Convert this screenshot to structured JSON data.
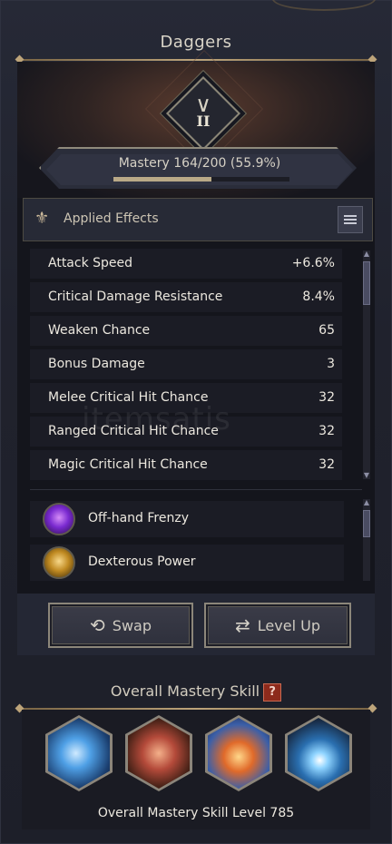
{
  "header": {
    "title": "Daggers"
  },
  "rank": {
    "numeral": "II"
  },
  "mastery": {
    "label": "Mastery 164/200 (55.9%)",
    "progress": 0.559
  },
  "effects": {
    "title": "Applied Effects",
    "stats": [
      {
        "name": "Attack Speed",
        "value": "+6.6%"
      },
      {
        "name": "Critical Damage Resistance",
        "value": "8.4%"
      },
      {
        "name": "Weaken Chance",
        "value": "65"
      },
      {
        "name": "Bonus Damage",
        "value": "3"
      },
      {
        "name": "Melee Critical Hit Chance",
        "value": "32"
      },
      {
        "name": "Ranged Critical Hit Chance",
        "value": "32"
      },
      {
        "name": "Magic Critical Hit Chance",
        "value": "32"
      }
    ],
    "skills": [
      {
        "name": "Off-hand Frenzy",
        "icon": "off-hand-frenzy-icon",
        "color": "#7a2ad0"
      },
      {
        "name": "Dexterous Power",
        "icon": "dexterous-power-icon",
        "color": "#c08a22"
      }
    ]
  },
  "buttons": {
    "swap": "Swap",
    "level_up": "Level Up"
  },
  "overall_skill": {
    "title": "Overall Mastery Skill",
    "help": "?",
    "level_label": "Overall Mastery Skill Level 785",
    "icons": [
      {
        "name": "lightning-slash-skill-icon",
        "color": "#2b6fb0"
      },
      {
        "name": "dynamite-hourglass-skill-icon",
        "color": "#8a3a2a"
      },
      {
        "name": "fire-orb-skill-icon",
        "color": "#c85a22"
      },
      {
        "name": "energy-burst-skill-icon",
        "color": "#1f4f86"
      }
    ]
  },
  "watermark": "itemsatis"
}
